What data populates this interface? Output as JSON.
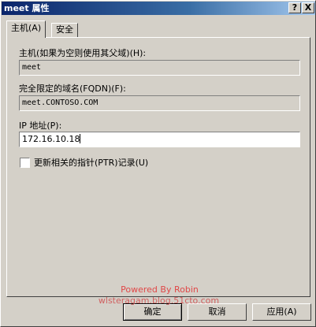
{
  "window": {
    "title": "meet 属性",
    "help_glyph": "?",
    "close_glyph": "X"
  },
  "tabs": [
    {
      "label": "主机(A)",
      "active": true
    },
    {
      "label": "安全",
      "active": false
    }
  ],
  "fields": {
    "host_label": "主机(如果为空则使用其父域)(H):",
    "host_value": "meet",
    "fqdn_label": "完全限定的域名(FQDN)(F):",
    "fqdn_value": "meet.CONTOSO.COM",
    "ip_label": "IP 地址(P):",
    "ip_value": "172.16.10.18"
  },
  "checkbox": {
    "label": "更新相关的指针(PTR)记录(U)",
    "checked": false
  },
  "watermark": {
    "line1": "Powered By Robin",
    "line2": "wlsteragam.blog.51cto.com"
  },
  "buttons": {
    "ok": "确定",
    "cancel": "取消",
    "apply": "应用(A)"
  }
}
